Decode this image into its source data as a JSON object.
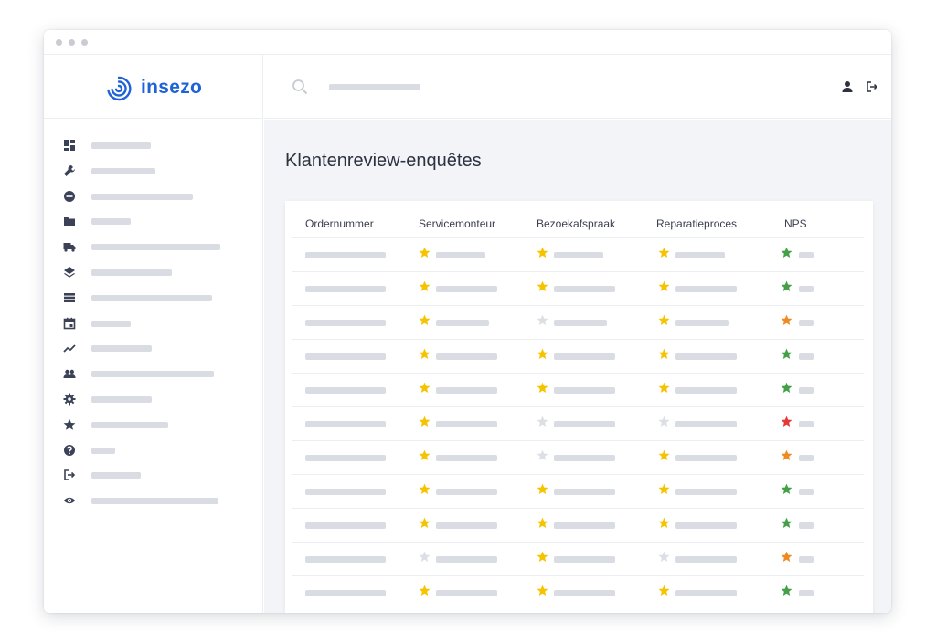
{
  "app": {
    "brand": "insezo",
    "brand_color": "#1f63d6"
  },
  "sidebar": {
    "items": [
      {
        "icon": "dashboard-icon"
      },
      {
        "icon": "wrench-icon"
      },
      {
        "icon": "add-circle-icon"
      },
      {
        "icon": "folder-icon"
      },
      {
        "icon": "truck-icon"
      },
      {
        "icon": "layers-icon"
      },
      {
        "icon": "list-icon"
      },
      {
        "icon": "calendar-icon"
      },
      {
        "icon": "trend-line-icon"
      },
      {
        "icon": "users-icon"
      },
      {
        "icon": "gear-icon"
      },
      {
        "icon": "star-icon"
      },
      {
        "icon": "help-icon"
      },
      {
        "icon": "logout-icon"
      },
      {
        "icon": "eye-icon"
      }
    ]
  },
  "topbar": {
    "search_icon": "search-icon",
    "user_icon": "user-icon",
    "logout_icon": "logout-icon"
  },
  "page": {
    "title": "Klantenreview-enquêtes"
  },
  "table": {
    "columns": [
      "Ordernummer",
      "Servicemonteur",
      "Bezoekafspraak",
      "Reparatieproces",
      "NPS"
    ],
    "colors": {
      "yellow": "#f5c300",
      "gray": "#dcdfe4",
      "green": "#43a047",
      "orange": "#ef8a22",
      "red": "#e53935"
    },
    "rows": [
      {
        "stars": [
          "yellow",
          "yellow",
          "yellow",
          "green"
        ]
      },
      {
        "stars": [
          "yellow",
          "yellow",
          "yellow",
          "green"
        ]
      },
      {
        "stars": [
          "yellow",
          "gray",
          "yellow",
          "orange"
        ]
      },
      {
        "stars": [
          "yellow",
          "yellow",
          "yellow",
          "green"
        ]
      },
      {
        "stars": [
          "yellow",
          "yellow",
          "yellow",
          "green"
        ]
      },
      {
        "stars": [
          "yellow",
          "gray",
          "gray",
          "red"
        ]
      },
      {
        "stars": [
          "yellow",
          "gray",
          "yellow",
          "orange"
        ]
      },
      {
        "stars": [
          "yellow",
          "yellow",
          "yellow",
          "green"
        ]
      },
      {
        "stars": [
          "yellow",
          "yellow",
          "yellow",
          "green"
        ]
      },
      {
        "stars": [
          "gray",
          "yellow",
          "gray",
          "orange"
        ]
      },
      {
        "stars": [
          "yellow",
          "yellow",
          "yellow",
          "green"
        ]
      }
    ]
  }
}
